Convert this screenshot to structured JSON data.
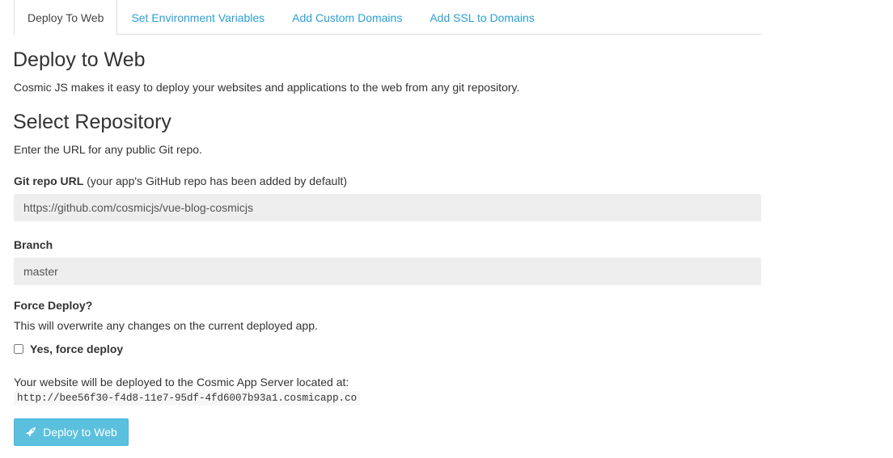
{
  "tabs": [
    {
      "label": "Deploy To Web",
      "active": true
    },
    {
      "label": "Set Environment Variables",
      "active": false
    },
    {
      "label": "Add Custom Domains",
      "active": false
    },
    {
      "label": "Add SSL to Domains",
      "active": false
    }
  ],
  "main": {
    "title": "Deploy to Web",
    "intro": "Cosmic JS makes it easy to deploy your websites and applications to the web from any git repository."
  },
  "repo_section": {
    "title": "Select Repository",
    "description": "Enter the URL for any public Git repo."
  },
  "git_repo": {
    "label_bold": "Git repo URL",
    "label_note": " (your app's GitHub repo has been added by default)",
    "value": "https://github.com/cosmicjs/vue-blog-cosmicjs"
  },
  "branch": {
    "label": "Branch",
    "value": "master"
  },
  "force_deploy": {
    "label": "Force Deploy?",
    "description": "This will overwrite any changes on the current deployed app.",
    "checkbox_label": "Yes, force deploy",
    "checked": false
  },
  "deploy_info": {
    "note": "Your website will be deployed to the Cosmic App Server located at:",
    "url": "http://bee56f30-f4d8-11e7-95df-4fd6007b93a1.cosmicapp.co"
  },
  "deploy_button": {
    "label": "Deploy to Web",
    "icon": "rocket-icon"
  },
  "colors": {
    "accent": "#2a9fd6",
    "button": "#5bc0de",
    "input_bg": "#eeeeee"
  }
}
